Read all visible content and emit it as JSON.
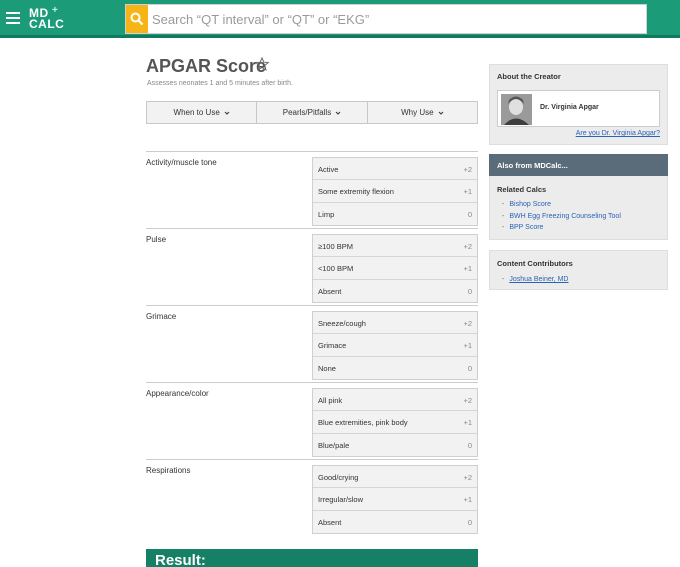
{
  "header": {
    "logo_line1": "MD",
    "logo_line2": "CALC",
    "logo_plus": "+",
    "search_placeholder": "Search “QT interval” or “QT” or “EKG”",
    "brand_color": "#1c9b78",
    "search_button_color": "#f6b416"
  },
  "calc": {
    "title": "APGAR Score",
    "subtitle": "Assesses neonates 1 and 5 minutes after birth.",
    "tabs": [
      {
        "label": "When to Use"
      },
      {
        "label": "Pearls/Pitfalls"
      },
      {
        "label": "Why Use"
      }
    ],
    "criteria": [
      {
        "label": "Activity/muscle tone",
        "options": [
          {
            "label": "Active",
            "value": "+2"
          },
          {
            "label": "Some extremity flexion",
            "value": "+1"
          },
          {
            "label": "Limp",
            "value": "0"
          }
        ]
      },
      {
        "label": "Pulse",
        "options": [
          {
            "label": "≥100 BPM",
            "value": "+2"
          },
          {
            "label": "<100 BPM",
            "value": "+1"
          },
          {
            "label": "Absent",
            "value": "0"
          }
        ]
      },
      {
        "label": "Grimace",
        "options": [
          {
            "label": "Sneeze/cough",
            "value": "+2"
          },
          {
            "label": "Grimace",
            "value": "+1"
          },
          {
            "label": "None",
            "value": "0"
          }
        ]
      },
      {
        "label": "Appearance/color",
        "options": [
          {
            "label": "All pink",
            "value": "+2"
          },
          {
            "label": "Blue extremities, pink body",
            "value": "+1"
          },
          {
            "label": "Blue/pale",
            "value": "0"
          }
        ]
      },
      {
        "label": "Respirations",
        "options": [
          {
            "label": "Good/crying",
            "value": "+2"
          },
          {
            "label": "Irregular/slow",
            "value": "+1"
          },
          {
            "label": "Absent",
            "value": "0"
          }
        ]
      }
    ],
    "result_label": "Result:"
  },
  "sidebar": {
    "about_title": "About the Creator",
    "creator_name": "Dr. Virginia Apgar",
    "creator_link": "Are you Dr. Virginia Apgar?",
    "also_title": "Also from MDCalc...",
    "related_title": "Related Calcs",
    "related": [
      {
        "label": "Bishop Score"
      },
      {
        "label": "BWH Egg Freezing Counseling Tool"
      },
      {
        "label": "BPP Score"
      }
    ],
    "contributors_title": "Content Contributors",
    "contributors": [
      {
        "label": "Joshua Beiner, MD"
      }
    ]
  }
}
